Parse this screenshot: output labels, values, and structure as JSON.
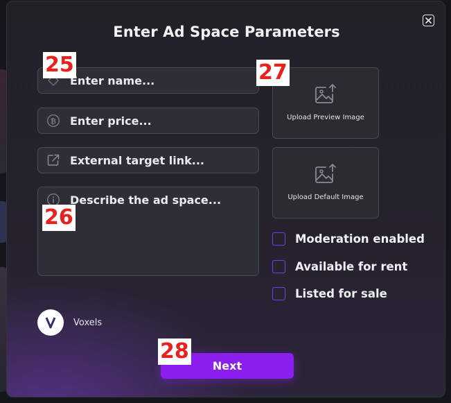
{
  "modal": {
    "title": "Enter Ad Space Parameters",
    "close_icon": "close-x-icon"
  },
  "form": {
    "name": {
      "placeholder": "Enter name...",
      "icon": "tag-icon"
    },
    "price": {
      "placeholder": "Enter price...",
      "icon": "bitcoin-icon"
    },
    "link": {
      "placeholder": "External target link...",
      "icon": "external-link-icon"
    },
    "description": {
      "placeholder": "Describe the ad space...",
      "icon": "info-icon"
    }
  },
  "uploads": {
    "preview": {
      "label": "Upload Preview Image",
      "icon": "image-upload-icon"
    },
    "default": {
      "label": "Upload Default Image",
      "icon": "image-upload-icon"
    }
  },
  "options": [
    {
      "label": "Moderation enabled",
      "checked": false
    },
    {
      "label": "Available for rent",
      "checked": false
    },
    {
      "label": "Listed for sale",
      "checked": false
    }
  ],
  "brand": {
    "name": "Voxels"
  },
  "actions": {
    "next_label": "Next"
  },
  "markers": {
    "m25": "25",
    "m26": "26",
    "m27": "27",
    "m28": "28"
  },
  "colors": {
    "accent": "#8a1ff0",
    "checkbox_border": "#7a3fe0",
    "panel": "#212128"
  }
}
